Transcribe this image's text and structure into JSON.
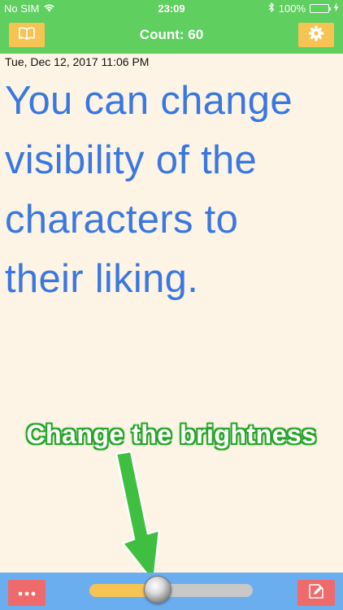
{
  "status_bar": {
    "carrier": "No SIM",
    "time": "23:09",
    "battery_text": "100%",
    "icons": [
      "wifi-icon",
      "bluetooth-icon",
      "battery-icon",
      "charging-icon"
    ]
  },
  "nav": {
    "title": "Count: 60",
    "left_icon": "book-icon",
    "right_icon": "gear-icon"
  },
  "content": {
    "date": "Tue, Dec 12, 2017 11:06 PM",
    "text_lines": [
      "You can change",
      "visibility of the",
      "characters to",
      "their liking."
    ]
  },
  "overlay": {
    "caption": "Change the brightness"
  },
  "toolbar": {
    "more_icon": "more-dots-icon",
    "edit_icon": "edit-icon",
    "brightness_level": 0.42
  },
  "colors": {
    "bar_green": "#5fcf5f",
    "nav_button": "#f7c453",
    "text_blue": "#3a78e0",
    "toolbar_blue": "#6aaeef",
    "toolbar_button": "#ef6a6a",
    "background": "#fdf4e6"
  }
}
